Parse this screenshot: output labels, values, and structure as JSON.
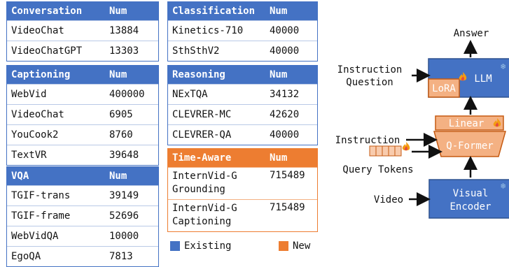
{
  "tables": {
    "conversation": {
      "title": "Conversation",
      "num": "Num",
      "rows": [
        [
          "VideoChat",
          "13884"
        ],
        [
          "VideoChatGPT",
          "13303"
        ]
      ]
    },
    "captioning": {
      "title": "Captioning",
      "num": "Num",
      "rows": [
        [
          "WebVid",
          "400000"
        ],
        [
          "VideoChat",
          "6905"
        ],
        [
          "YouCook2",
          "8760"
        ],
        [
          "TextVR",
          "39648"
        ]
      ]
    },
    "vqa": {
      "title": "VQA",
      "num": "Num",
      "rows": [
        [
          "TGIF-trans",
          "39149"
        ],
        [
          "TGIF-frame",
          "52696"
        ],
        [
          "WebVidQA",
          "10000"
        ],
        [
          "EgoQA",
          "7813"
        ]
      ]
    },
    "classification": {
      "title": "Classification",
      "num": "Num",
      "rows": [
        [
          "Kinetics-710",
          "40000"
        ],
        [
          "SthSthV2",
          "40000"
        ]
      ]
    },
    "reasoning": {
      "title": "Reasoning",
      "num": "Num",
      "rows": [
        [
          "NExTQA",
          "34132"
        ],
        [
          "CLEVRER-MC",
          "42620"
        ],
        [
          "CLEVRER-QA",
          "40000"
        ]
      ]
    },
    "timeaware": {
      "title": "Time-Aware",
      "num": "Num",
      "rows": [
        [
          "InternVid-G\nGrounding",
          "715489"
        ],
        [
          "InternVid-G\nCaptioning",
          "715489"
        ]
      ]
    }
  },
  "legend": {
    "existing": "Existing",
    "new": "New",
    "existing_color": "#4472c4",
    "new_color": "#ed7d31"
  },
  "diagram": {
    "answer": "Answer",
    "instruction_question_1": "Instruction",
    "instruction_question_2": "Question",
    "llm": "LLM",
    "lora": "LoRA",
    "linear": "Linear",
    "qformer": "Q-Former",
    "instruction": "Instruction",
    "query_tokens": "Query Tokens",
    "video": "Video",
    "visual_encoder_1": "Visual",
    "visual_encoder_2": "Encoder",
    "fire_icon": "fire-icon",
    "snow_icon": "snowflake-icon"
  }
}
